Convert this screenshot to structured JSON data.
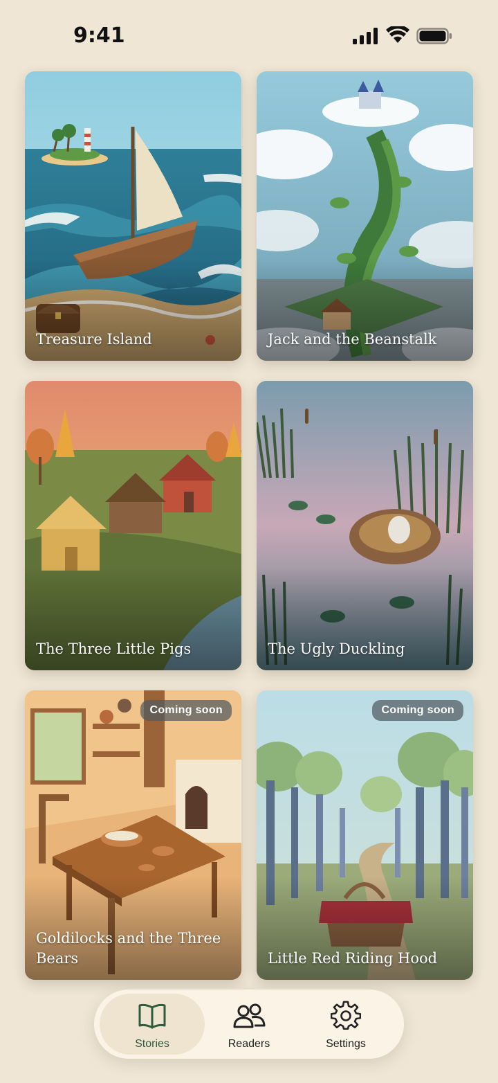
{
  "status_bar": {
    "time": "9:41"
  },
  "stories": [
    {
      "title": "Treasure Island",
      "badge": ""
    },
    {
      "title": "Jack and the Beanstalk",
      "badge": ""
    },
    {
      "title": "The Three Little Pigs",
      "badge": ""
    },
    {
      "title": "The Ugly Duckling",
      "badge": ""
    },
    {
      "title": "Goldilocks and the Three Bears",
      "badge": "Coming soon"
    },
    {
      "title": "Little Red Riding Hood",
      "badge": "Coming soon"
    }
  ],
  "tabbar": {
    "tabs": [
      {
        "label": "Stories",
        "icon": "book-icon",
        "active": true
      },
      {
        "label": "Readers",
        "icon": "people-icon",
        "active": false
      },
      {
        "label": "Settings",
        "icon": "gear-icon",
        "active": false
      }
    ]
  },
  "colors": {
    "background": "#efe6d6",
    "accent": "#2f5a3c",
    "badge": "#50595f"
  }
}
